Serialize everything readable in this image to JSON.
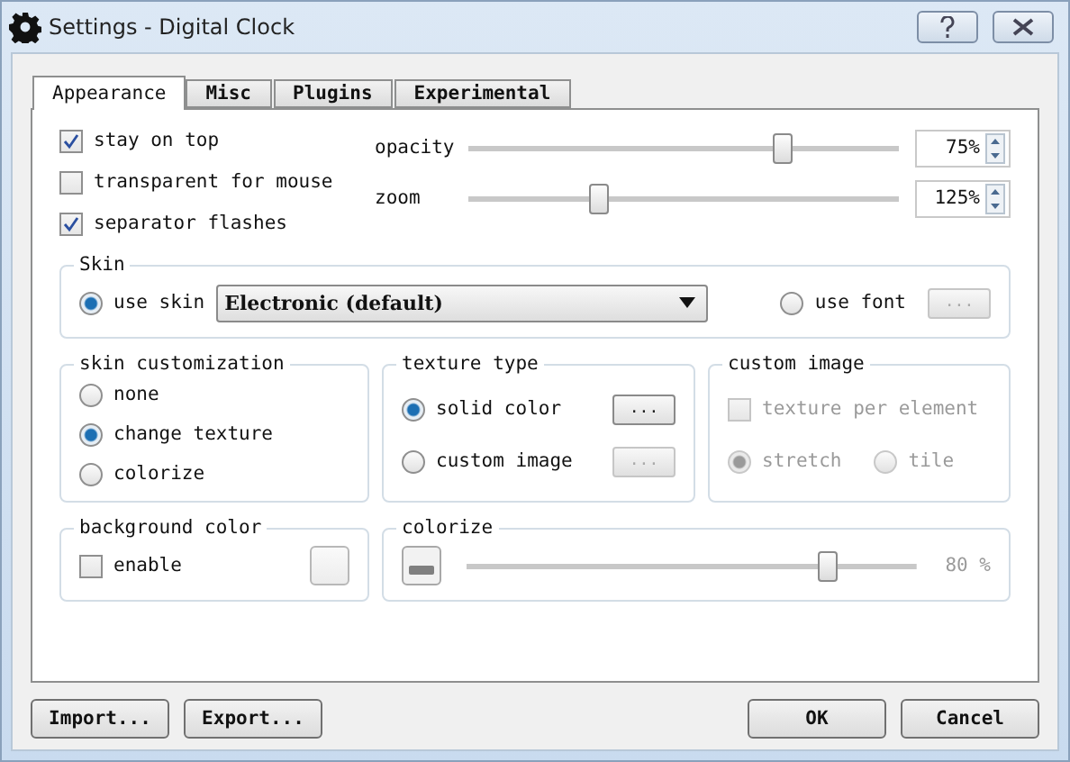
{
  "window": {
    "title": "Settings - Digital Clock"
  },
  "tabs": [
    {
      "label": "Appearance",
      "selected": true
    },
    {
      "label": "Misc",
      "selected": false
    },
    {
      "label": "Plugins",
      "selected": false
    },
    {
      "label": "Experimental",
      "selected": false
    }
  ],
  "options": [
    {
      "label": "stay on top",
      "checked": true
    },
    {
      "label": "transparent for mouse",
      "checked": false
    },
    {
      "label": "separator flashes",
      "checked": true
    }
  ],
  "sliders": [
    {
      "label": "opacity",
      "level": 0.73,
      "value": "75%"
    },
    {
      "label": "zoom",
      "level": 0.3,
      "value": "125%"
    }
  ],
  "skin": {
    "title": "Skin",
    "use_skin": {
      "label": "use skin",
      "selected": true
    },
    "dropdown": "Electronic (default)",
    "use_font": {
      "label": "use font",
      "selected": false
    },
    "font_button": "..."
  },
  "skin_customization": {
    "title": "skin customization",
    "options": [
      {
        "label": "none",
        "selected": false
      },
      {
        "label": "change texture",
        "selected": true
      },
      {
        "label": "colorize",
        "selected": false
      }
    ]
  },
  "texture_type": {
    "title": "texture type",
    "options": [
      {
        "label": "solid color",
        "selected": true,
        "button": "...",
        "disabled": false
      },
      {
        "label": "custom image",
        "selected": false,
        "button": "...",
        "disabled": true
      }
    ]
  },
  "custom_image": {
    "title": "custom image",
    "disabled": true,
    "checkbox": {
      "label": "texture per element",
      "checked": false
    },
    "options": [
      {
        "label": "stretch",
        "selected": true
      },
      {
        "label": "tile",
        "selected": false
      }
    ]
  },
  "background_color": {
    "title": "background color",
    "checkbox": {
      "label": "enable",
      "checked": false
    }
  },
  "colorize": {
    "title": "colorize",
    "disabled": true,
    "level": 0.8,
    "reading": "80 %"
  },
  "buttons_left": [
    "Import...",
    "Export..."
  ],
  "buttons_right": [
    "OK",
    "Cancel"
  ]
}
